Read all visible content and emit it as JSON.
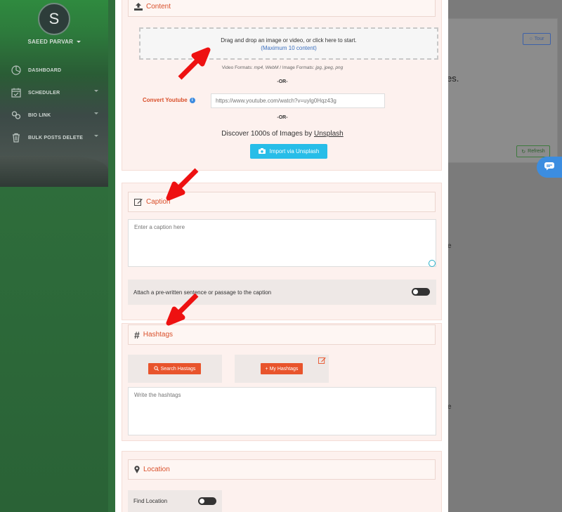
{
  "sidebar": {
    "avatar_letter": "S",
    "user_name": "SAEED PARVAR",
    "items": [
      {
        "label": "DASHBOARD",
        "icon": "dashboard-icon"
      },
      {
        "label": "SCHEDULER",
        "icon": "calendar-icon"
      },
      {
        "label": "BIO LINK",
        "icon": "link-icon"
      },
      {
        "label": "BULK POSTS DELETE",
        "icon": "trash-icon"
      }
    ]
  },
  "background": {
    "tour_label": "Tour",
    "text_fragment": "es.",
    "refresh_label": "Refresh",
    "frag1": "e",
    "frag2": "e"
  },
  "content": {
    "title": "Content",
    "dropzone_text": "Drag and drop an image or video, or click here to start.",
    "dropzone_max": "(Maximum 10 content)",
    "video_formats_label": "Video Formats: ",
    "video_formats": "mp4, WebM",
    "image_formats_label": " / Image Formats: ",
    "image_formats": "jpg, jpeg, png",
    "or1": "-OR-",
    "youtube_label": "Convert Youtube",
    "youtube_placeholder": "https://www.youtube.com/watch?v=uylg0Hqz43g",
    "or2": "-OR-",
    "discover_text": "Discover 1000s of Images by ",
    "discover_link": "Unsplash",
    "unsplash_button": "Import via Unsplash"
  },
  "caption": {
    "title": "Caption",
    "placeholder": "Enter a caption here",
    "attach_label": "Attach a pre-written sentence or passage to the caption",
    "attach_enabled": false
  },
  "hashtags": {
    "title": "Hashtags",
    "search_button": "Search Hastags",
    "my_button": "+ My Hashtags",
    "placeholder": "Write the hashtags"
  },
  "location": {
    "title": "Location",
    "find_label": "Find Location",
    "find_enabled": false
  },
  "colors": {
    "accent": "#d94f2a",
    "button_orange": "#e8542c",
    "unsplash_blue": "#27bde8",
    "arrow_red": "#ee1111"
  }
}
